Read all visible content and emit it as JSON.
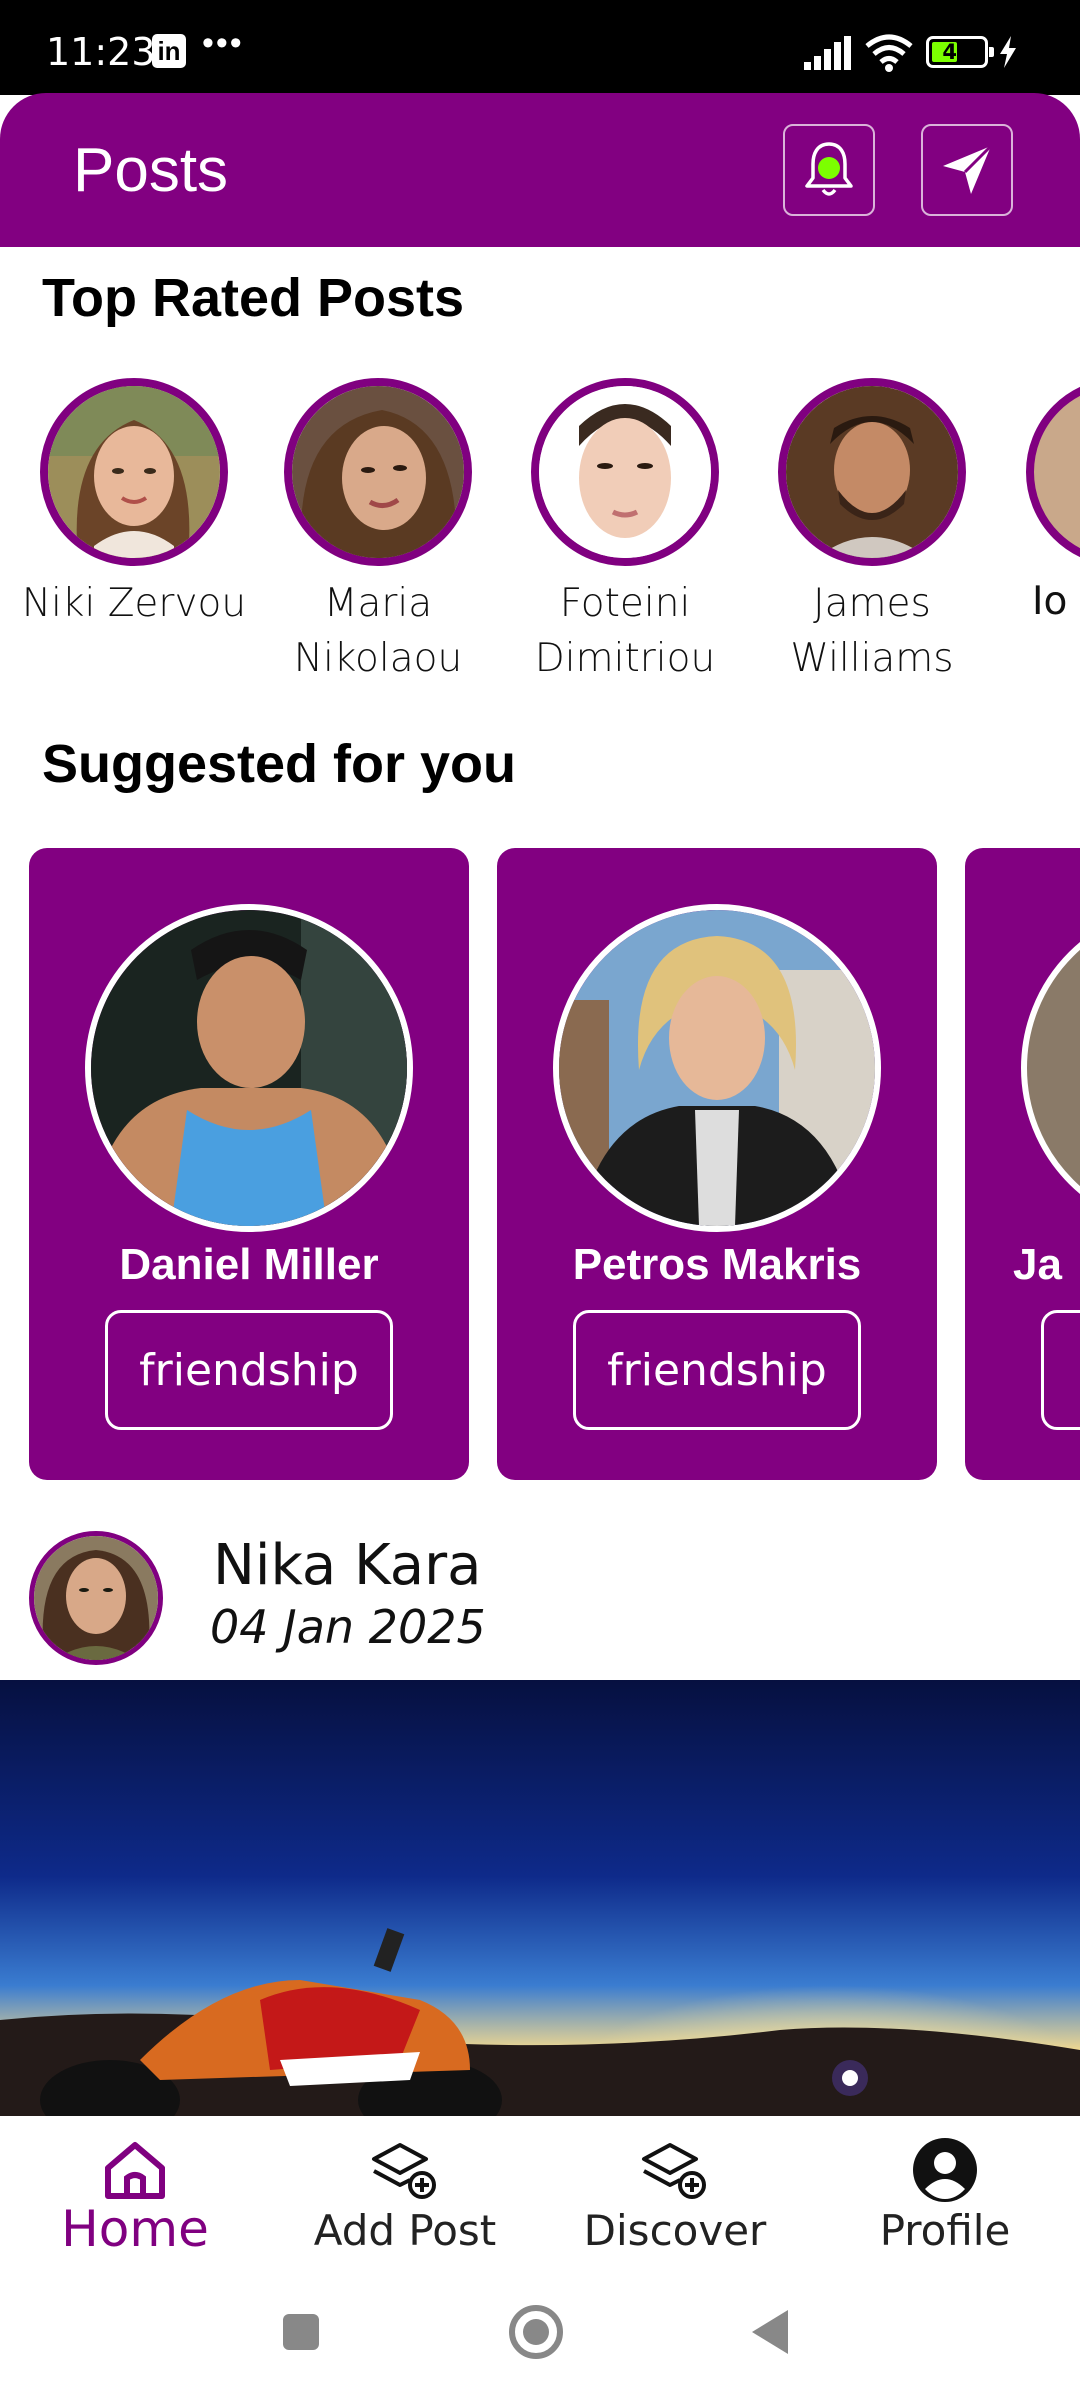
{
  "status_bar": {
    "time": "11:23",
    "linkedin": "in",
    "more": "•••",
    "battery": "49",
    "battery_level": 0.49
  },
  "app_bar": {
    "title": "Posts"
  },
  "top_rated": {
    "title": "Top Rated Posts",
    "users": [
      {
        "name": "Niki Zervou"
      },
      {
        "name": "Maria Nikolaou"
      },
      {
        "name": "Foteini Dimitriou"
      },
      {
        "name": "James Williams"
      },
      {
        "name": "Io"
      }
    ]
  },
  "suggested": {
    "title": "Suggested for you",
    "cards": [
      {
        "name": "Daniel Miller",
        "button": "friendship"
      },
      {
        "name": "Petros Makris",
        "button": "friendship"
      },
      {
        "name": "Ja"
      }
    ]
  },
  "post": {
    "author": "Nika Kara",
    "date": "04 Jan 2025"
  },
  "bottom_nav": {
    "items": [
      {
        "label": "Home",
        "icon": "home-icon",
        "active": true
      },
      {
        "label": "Add Post",
        "icon": "add-post-icon"
      },
      {
        "label": "Discover",
        "icon": "discover-icon"
      },
      {
        "label": "Profile",
        "icon": "profile-icon"
      }
    ]
  },
  "colors": {
    "primary": "#820081",
    "accent_green": "#7cff00"
  }
}
